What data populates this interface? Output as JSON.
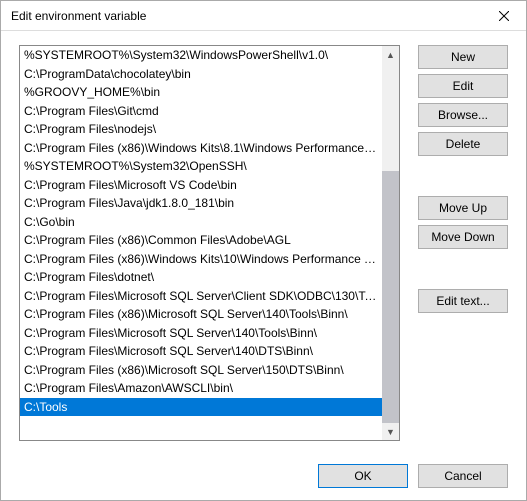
{
  "window": {
    "title": "Edit environment variable"
  },
  "list": {
    "items": [
      "%SYSTEMROOT%\\System32\\WindowsPowerShell\\v1.0\\",
      "C:\\ProgramData\\chocolatey\\bin",
      "%GROOVY_HOME%\\bin",
      "C:\\Program Files\\Git\\cmd",
      "C:\\Program Files\\nodejs\\",
      "C:\\Program Files (x86)\\Windows Kits\\8.1\\Windows Performance To...",
      "%SYSTEMROOT%\\System32\\OpenSSH\\",
      "C:\\Program Files\\Microsoft VS Code\\bin",
      "C:\\Program Files\\Java\\jdk1.8.0_181\\bin",
      "C:\\Go\\bin",
      "C:\\Program Files (x86)\\Common Files\\Adobe\\AGL",
      "C:\\Program Files (x86)\\Windows Kits\\10\\Windows Performance To...",
      "C:\\Program Files\\dotnet\\",
      "C:\\Program Files\\Microsoft SQL Server\\Client SDK\\ODBC\\130\\Tool...",
      "C:\\Program Files (x86)\\Microsoft SQL Server\\140\\Tools\\Binn\\",
      "C:\\Program Files\\Microsoft SQL Server\\140\\Tools\\Binn\\",
      "C:\\Program Files\\Microsoft SQL Server\\140\\DTS\\Binn\\",
      "C:\\Program Files (x86)\\Microsoft SQL Server\\150\\DTS\\Binn\\",
      "C:\\Program Files\\Amazon\\AWSCLI\\bin\\",
      "C:\\Tools"
    ],
    "selected_index": 19
  },
  "buttons": {
    "new": "New",
    "edit": "Edit",
    "browse": "Browse...",
    "delete": "Delete",
    "move_up": "Move Up",
    "move_down": "Move Down",
    "edit_text": "Edit text...",
    "ok": "OK",
    "cancel": "Cancel"
  }
}
